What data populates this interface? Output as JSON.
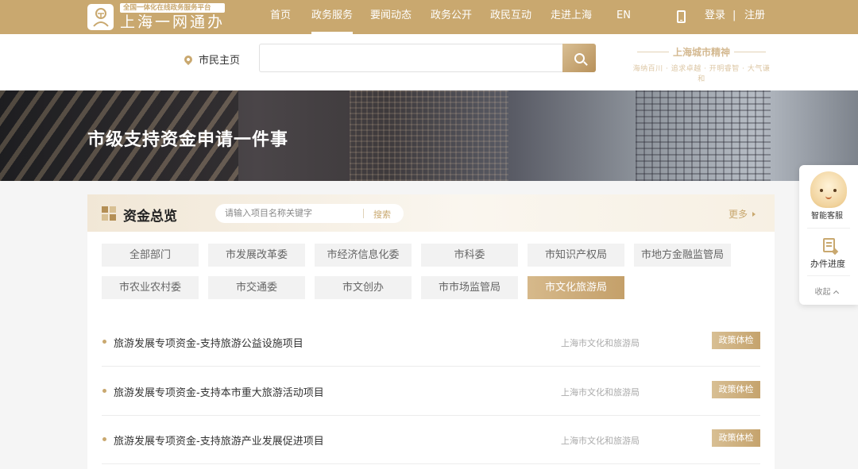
{
  "header": {
    "logo_subtitle": "全国一体化在线政务服务平台",
    "logo_title": "上海一网通办",
    "nav": [
      "首页",
      "政务服务",
      "要闻动态",
      "政务公开",
      "政民互动",
      "走进上海",
      "EN"
    ],
    "active_nav": "政务服务",
    "login": "登录",
    "separator": "|",
    "register": "注册"
  },
  "search": {
    "location_label": "市民主页",
    "placeholder": "",
    "spirit_title": "上海城市精神",
    "spirit_subtitle": "海纳百川 · 追求卓越 · 开明睿智 · 大气谦和"
  },
  "banner": {
    "title": "市级支持资金申请一件事"
  },
  "fund": {
    "title": "资金总览",
    "search_placeholder": "请输入项目名称关键字",
    "search_button": "搜索",
    "more": "更多",
    "departments": [
      "全部部门",
      "市发展改革委",
      "市经济信息化委",
      "市科委",
      "市知识产权局",
      "市地方金融监管局",
      "市农业农村委",
      "市交通委",
      "市文创办",
      "市市场监管局",
      "市文化旅游局"
    ],
    "active_department": "市文化旅游局",
    "items": [
      {
        "name": "旅游发展专项资金-支持旅游公益设施项目",
        "org": "上海市文化和旅游局",
        "tag": "政策体检"
      },
      {
        "name": "旅游发展专项资金-支持本市重大旅游活动项目",
        "org": "上海市文化和旅游局",
        "tag": "政策体检"
      },
      {
        "name": "旅游发展专项资金-支持旅游产业发展促进项目",
        "org": "上海市文化和旅游局",
        "tag": "政策体检"
      }
    ]
  },
  "float_panel": {
    "assistant": "智能客服",
    "progress": "办件进度",
    "collapse": "收起"
  },
  "colors": {
    "brand_gold": "#c9a86f",
    "banner_title": "#ffffff"
  }
}
